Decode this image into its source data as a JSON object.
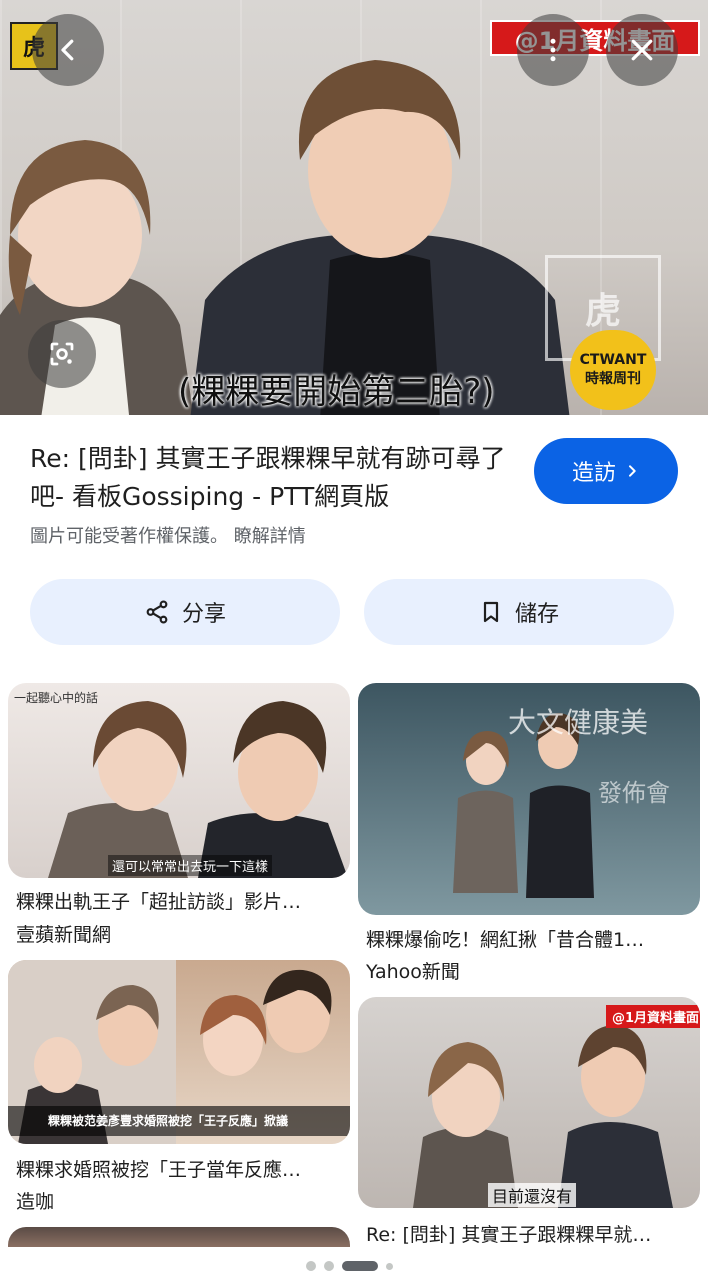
{
  "hero": {
    "logo_text": "虎",
    "badge": "@1月資料畫面",
    "watermark": "虎",
    "mic_label": "CTWANT",
    "mic_sub": "時報周刊",
    "subtitle": "(粿粿要開始第二胎?)"
  },
  "result": {
    "title": "Re: [問卦] 其實王子跟粿粿早就有跡可尋了吧- 看板Gossiping - PTT網頁版",
    "visit_label": "造訪",
    "copyright_notice": "圖片可能受著作權保護。",
    "learn_more": "瞭解詳情",
    "share_label": "分享",
    "save_label": "儲存"
  },
  "grid": [
    {
      "caption": "粿粿出軌王子「超扯訪談」影片…",
      "source": "壹蘋新聞網",
      "overlay_top": "一起聽心中的話",
      "overlay_sub": "還可以常常出去玩一下這樣"
    },
    {
      "caption": "粿粿爆偷吃！網紅揪「昔合體1…",
      "source": "Yahoo新聞",
      "overlay_top": "大文健康美",
      "overlay_sub": "發佈會"
    },
    {
      "caption": "粿粿求婚照被挖「王子當年反應…",
      "source": "造咖",
      "overlay_sub": "粿粿被范姜彥豐求婚照被挖「王子反應」掀議"
    },
    {
      "caption": "Re: [問卦] 其實王子跟粿粿早就…",
      "source": "",
      "overlay_top": "@1月資料畫面",
      "overlay_sub": "目前還沒有"
    }
  ],
  "colors": {
    "accent": "#0b63e5",
    "chip": "#e8f0fe",
    "badge": "#d6191a"
  }
}
